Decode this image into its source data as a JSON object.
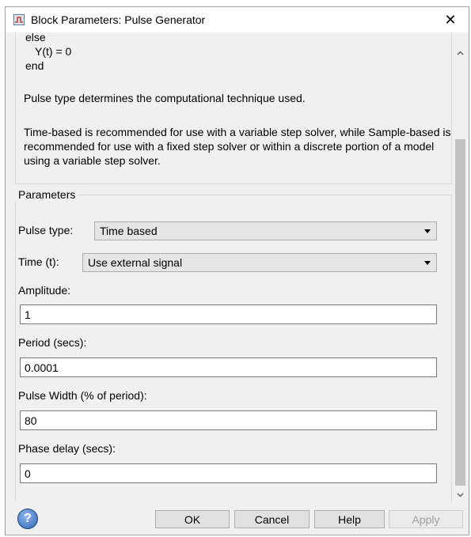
{
  "window": {
    "title": "Block Parameters: Pulse Generator",
    "close_label": "✕"
  },
  "description": {
    "code_lines": [
      "else",
      "Y(t) = 0",
      "end"
    ],
    "paragraph_1": "Pulse type determines the computational technique used.",
    "paragraph_2": "Time-based is recommended for use with a variable step solver, while Sample-based is recommended for use with a fixed step solver or within a discrete portion of a model using a variable step solver."
  },
  "parameters": {
    "group_label": "Parameters",
    "pulse_type": {
      "label": "Pulse type:",
      "value": "Time based"
    },
    "time": {
      "label": "Time (t):",
      "value": "Use external signal"
    },
    "amplitude": {
      "label": "Amplitude:",
      "value": "1"
    },
    "period": {
      "label": "Period (secs):",
      "value": "0.0001"
    },
    "pulse_width": {
      "label": "Pulse Width (% of period):",
      "value": "80"
    },
    "phase_delay": {
      "label": "Phase delay (secs):",
      "value": "0"
    }
  },
  "buttons": {
    "help_icon": "?",
    "ok": "OK",
    "cancel": "Cancel",
    "help": "Help",
    "apply": "Apply"
  },
  "colors": {
    "dialog_background": "#f0f0f0",
    "help_icon_blue": "#2f66b4",
    "disabled_text": "#a0a0a0"
  }
}
